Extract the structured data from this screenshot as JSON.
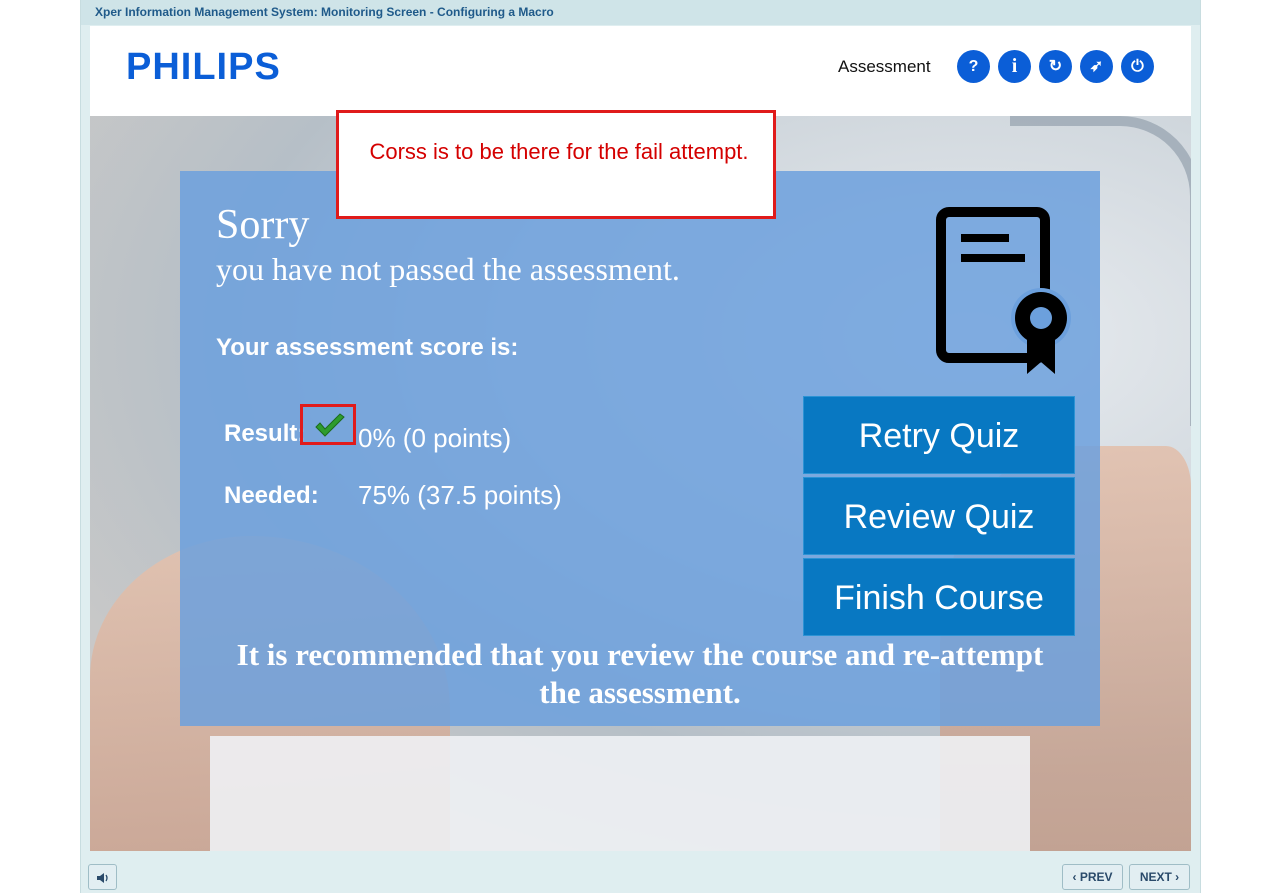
{
  "window": {
    "title": "Xper Information Management System: Monitoring Screen - Configuring a Macro"
  },
  "header": {
    "logo": "PHILIPS",
    "section_label": "Assessment",
    "buttons": [
      {
        "icon": "help-icon",
        "glyph": "?"
      },
      {
        "icon": "info-icon",
        "glyph": "i"
      },
      {
        "icon": "refresh-icon",
        "glyph": "↻"
      },
      {
        "icon": "compass-icon",
        "glyph": "➶"
      },
      {
        "icon": "power-icon",
        "glyph": "⏻"
      }
    ]
  },
  "panel": {
    "heading": "Sorry",
    "subheading": "you have not passed the assessment.",
    "score_label": "Your assessment score is:",
    "result_label": "Result:",
    "result_value": "0% (0 points)",
    "needed_label": "Needed:",
    "needed_value": "75% (37.5 points)",
    "buttons": {
      "retry": "Retry Quiz",
      "review": "Review Quiz",
      "finish": "Finish Course"
    },
    "recommendation": "It is recommended that you review the course and re-attempt the assessment."
  },
  "callout": {
    "text": "Corss is to be there for the fail attempt."
  },
  "footer": {
    "prev_label": "PREV",
    "next_label": "NEXT"
  },
  "colors": {
    "brand_blue": "#0b5ed7",
    "panel_blue": "#6ca0dd",
    "button_blue": "#0878c2",
    "callout_red": "#e01b1b",
    "check_green": "#2e9c2e"
  }
}
